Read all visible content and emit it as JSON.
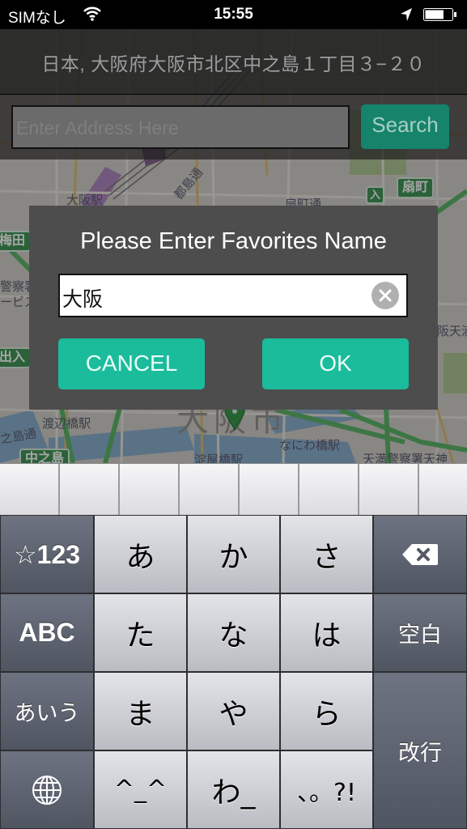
{
  "status_bar": {
    "carrier": "SIMなし",
    "time": "15:55",
    "battery_level": 0.7,
    "icons": [
      "wifi-icon",
      "location-arrow-icon",
      "battery-icon"
    ]
  },
  "header": {
    "address": "日本, 大阪府大阪市北区中之島１丁目３−２０"
  },
  "search": {
    "placeholder": "Enter Address Here",
    "value": "",
    "button_label": "Search"
  },
  "map": {
    "labels": [
      "大阪駅",
      "都島通",
      "扇町通",
      "警察署",
      "ービス",
      "渡辺橋駅",
      "之島通",
      "なにわ橋駅",
      "淀屋橋駅",
      "天満警察署天神",
      "阪天満"
    ],
    "signs": [
      "扇町",
      "入",
      "梅田",
      "出入",
      "中之島"
    ],
    "city_label": "大阪市",
    "pin": "map-pin-icon"
  },
  "dialog": {
    "title": "Please Enter Favorites Name",
    "name_value": "大阪",
    "cancel_label": "CANCEL",
    "ok_label": "OK"
  },
  "keyboard": {
    "candidates": [
      "",
      "",
      "",
      "",
      "",
      "",
      "",
      ""
    ],
    "rows": [
      [
        "☆123",
        "あ",
        "か",
        "さ",
        "⌫"
      ],
      [
        "ABC",
        "た",
        "な",
        "は",
        "空白"
      ],
      [
        "あいう",
        "ま",
        "や",
        "ら",
        "改行"
      ],
      [
        "🌐",
        "^^",
        "わ_",
        "、。?!"
      ]
    ],
    "keys": {
      "numbers": "☆123",
      "a": "あ",
      "ka": "か",
      "sa": "さ",
      "abc": "ABC",
      "ta": "た",
      "na": "な",
      "ha": "は",
      "space": "空白",
      "kana": "あいう",
      "ma": "ま",
      "ya": "や",
      "ra": "ら",
      "return": "改行",
      "emoticon": "^_^",
      "wa": "わ_",
      "punct": "、。?!"
    }
  }
}
